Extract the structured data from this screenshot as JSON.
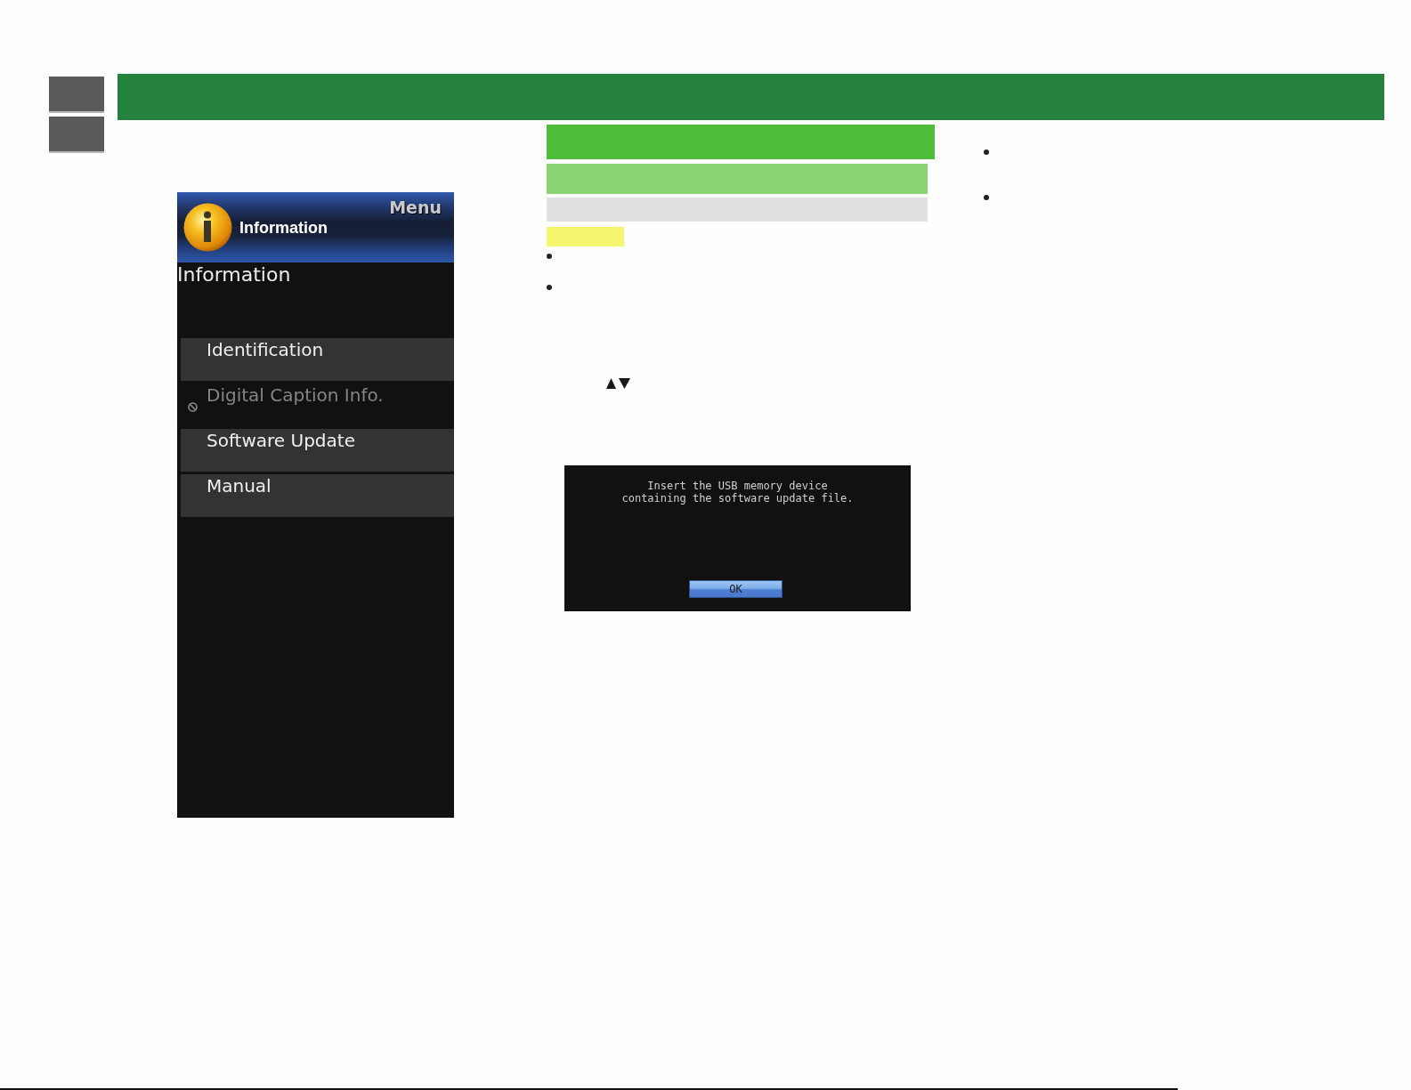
{
  "menu_screen": {
    "header": {
      "menu_label": "Menu",
      "title": "Information"
    },
    "subtitle": "Information",
    "items": [
      {
        "label": "Identification",
        "disabled": false
      },
      {
        "label": "Digital Caption Info.",
        "disabled": true
      },
      {
        "label": "Software Update",
        "disabled": false
      },
      {
        "label": "Manual",
        "disabled": false
      }
    ]
  },
  "dialog_screen": {
    "message": "Insert the USB memory device\ncontaining the software update file.",
    "button": "OK"
  }
}
